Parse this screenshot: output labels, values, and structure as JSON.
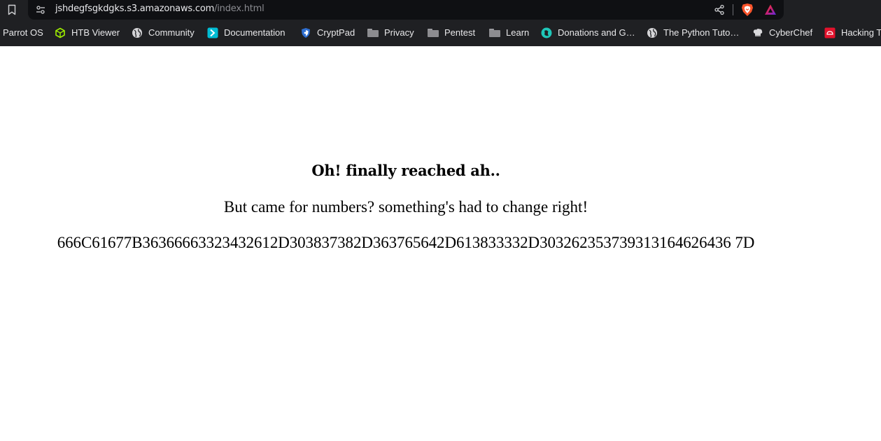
{
  "browser": {
    "url_host": "jshdegfsgkdgks.s3.amazonaws.com",
    "url_path": "/index.html",
    "icons": {
      "bookmark_page": "bookmark-icon",
      "site_info": "tune-icon",
      "share": "share-icon",
      "shields": "brave-shields-icon",
      "rewards": "brave-rewards-icon"
    }
  },
  "bookmarks": [
    {
      "label": "Parrot OS",
      "icon": "none"
    },
    {
      "label": "HTB Viewer",
      "icon": "cube-icon"
    },
    {
      "label": "Community",
      "icon": "globe-icon"
    },
    {
      "label": "Documentation",
      "icon": "docs-icon"
    },
    {
      "label": "CryptPad",
      "icon": "shield-icon"
    },
    {
      "label": "Privacy",
      "icon": "folder-icon"
    },
    {
      "label": "Pentest",
      "icon": "folder-icon"
    },
    {
      "label": "Learn",
      "icon": "folder-icon"
    },
    {
      "label": "Donations and G…",
      "icon": "donations-icon"
    },
    {
      "label": "The Python Tuto…",
      "icon": "globe-icon"
    },
    {
      "label": "CyberChef",
      "icon": "chef-icon"
    },
    {
      "label": "Hacking T",
      "icon": "hacking-icon"
    }
  ],
  "content": {
    "heading": "Oh! finally reached ah..",
    "subtext": "But came for numbers? something's had to change right!",
    "hex": "666C61677B36366663323432612D303837382D363765642D613833332D303262353739313164626436 7D"
  },
  "colors": {
    "chrome_bg": "#1f2023",
    "urlbar_bg": "#0f1013",
    "url_host": "#e9e9ec",
    "url_path": "#8a8b90",
    "brave_orange": "#fb542b",
    "htb_green": "#9fef00",
    "docs_cyan": "#00bcd4"
  }
}
